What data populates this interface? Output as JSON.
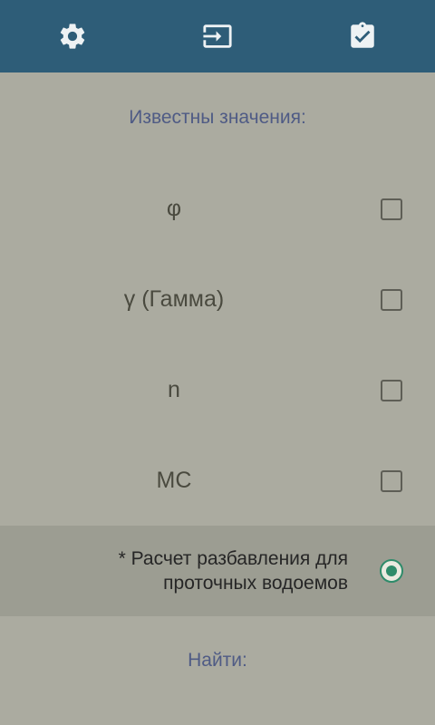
{
  "toolbar": {
    "icons": [
      "gear-icon",
      "input-icon",
      "clipboard-check-icon"
    ],
    "color": "#2e5d78"
  },
  "known_heading": "Известны значения:",
  "params": [
    {
      "label": "φ",
      "checked": false
    },
    {
      "label": "γ (Гамма)",
      "checked": false
    },
    {
      "label": "n",
      "checked": false
    },
    {
      "label": "МС",
      "checked": false
    }
  ],
  "dilution_option": {
    "line1": "* Расчет разбавления для",
    "line2": "проточных водоемов",
    "selected": true
  },
  "find_heading": "Найти:",
  "colors": {
    "background": "#ababa0",
    "accent": "#2e8b6a",
    "heading": "#4f5b85"
  }
}
